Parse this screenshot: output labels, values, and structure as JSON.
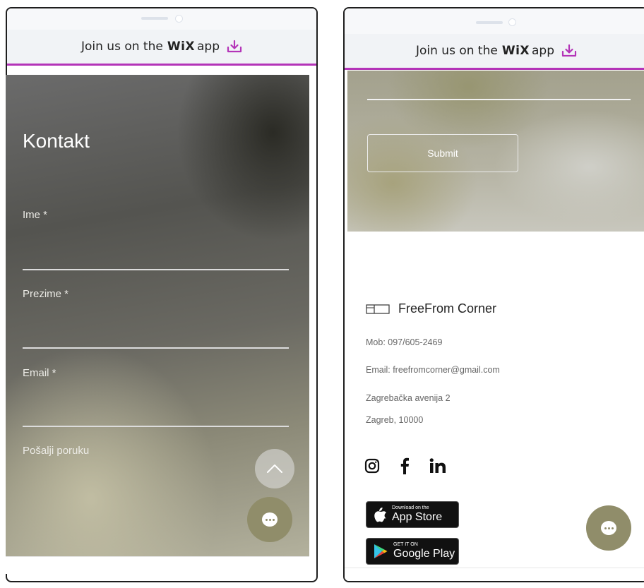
{
  "banner": {
    "prefix": "Join us on the",
    "brand": "WiX",
    "suffix": "app"
  },
  "left": {
    "title": "Kontakt",
    "fields": [
      {
        "label": "Ime *"
      },
      {
        "label": "Prezime *"
      },
      {
        "label": "Email *"
      },
      {
        "label": "Pošalji poruku"
      }
    ]
  },
  "right": {
    "submit_label": "Submit",
    "brand_name": "FreeFrom Corner",
    "phone": "Mob: 097/605-2469",
    "email": "Email: freefromcorner@gmail.com",
    "address_line1": "Zagrebačka avenija 2",
    "address_line2": "Zagreb, 10000",
    "social": [
      "instagram",
      "facebook",
      "linkedin"
    ],
    "app_store": {
      "small": "Download on the",
      "big": "App Store"
    },
    "google_play": {
      "small": "GET IT ON",
      "big": "Google Play"
    }
  },
  "colors": {
    "accent": "#b434b8",
    "chat": "#908d6a"
  }
}
